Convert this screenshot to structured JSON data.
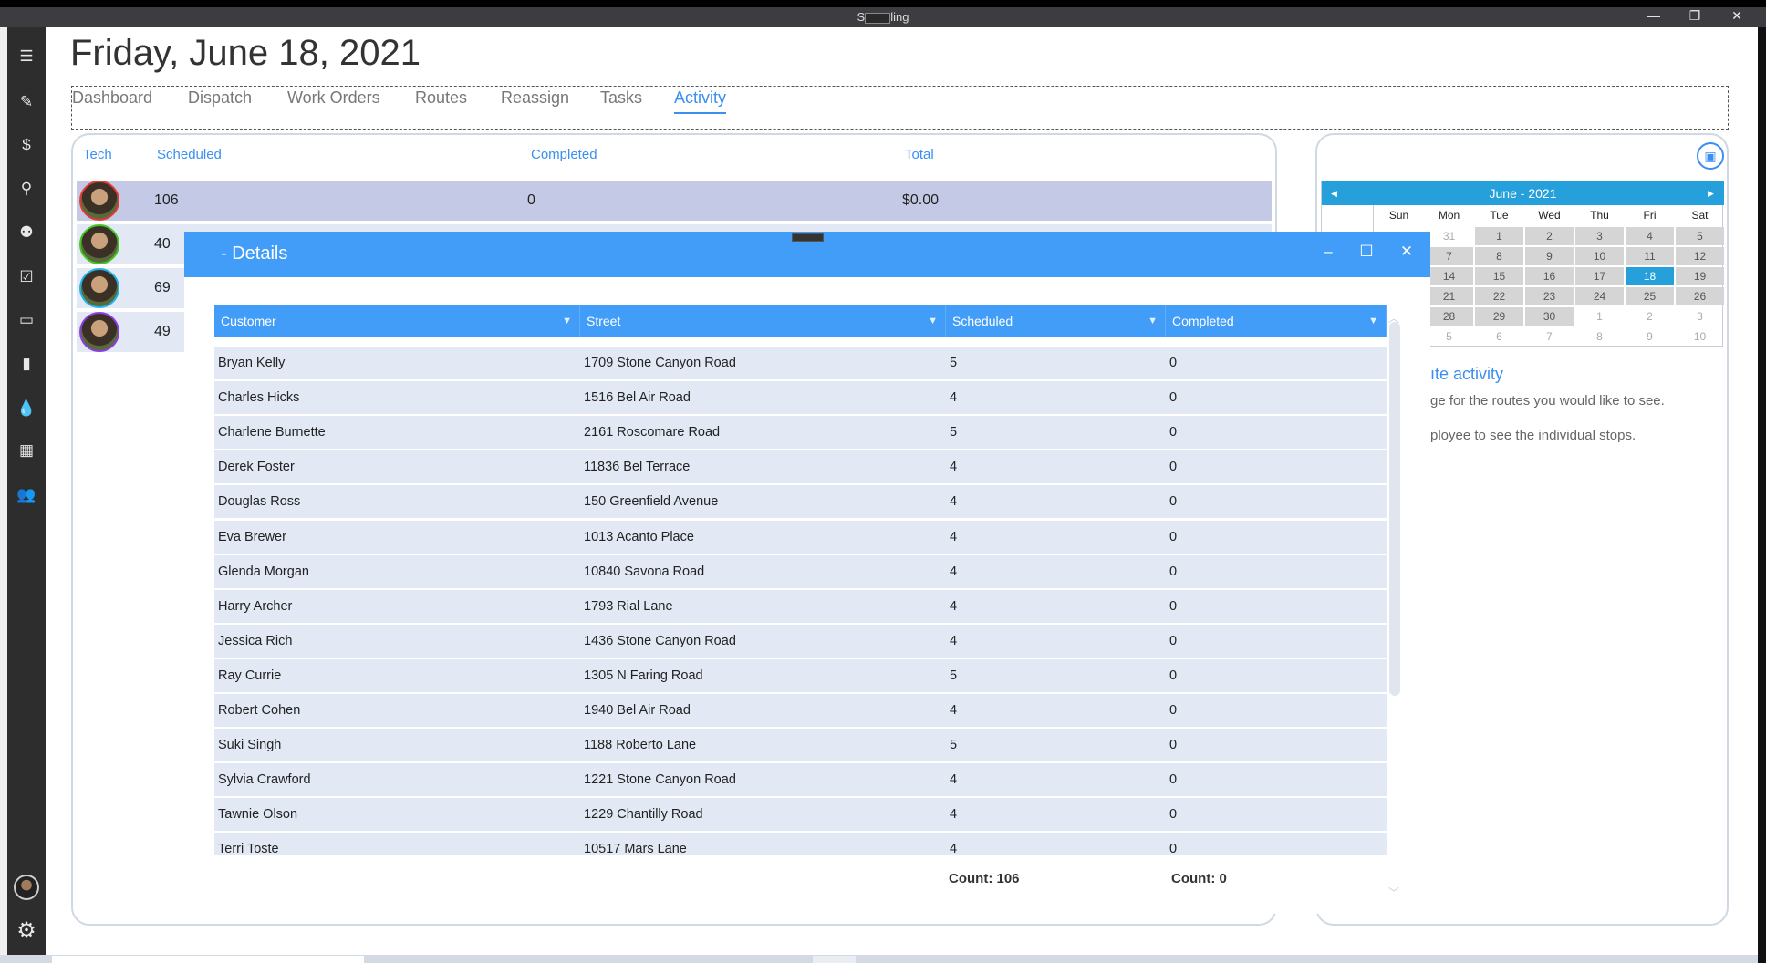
{
  "window": {
    "title_start": "S",
    "title_end": "ling",
    "minimize": "—",
    "restore": "❐",
    "close": "✕"
  },
  "sidebar": {
    "icons": [
      "menu-icon",
      "edit-icon",
      "billing-icon",
      "customer-search-icon",
      "team-icon",
      "clipboard-check-icon",
      "money-icon",
      "chart-icon",
      "water-drop-icon",
      "calendar-icon",
      "users-icon"
    ],
    "glyphs": [
      "☰",
      "✎",
      "$",
      "⚲",
      "⚉",
      "☑",
      "▭",
      "▮",
      "💧",
      "▦",
      "👥"
    ],
    "settings_glyph": "⚙"
  },
  "header": {
    "title": "Friday, June 18, 2021"
  },
  "tabs": [
    {
      "label": "Dashboard"
    },
    {
      "label": "Dispatch"
    },
    {
      "label": "Work Orders"
    },
    {
      "label": "Routes"
    },
    {
      "label": "Reassign"
    },
    {
      "label": "Tasks"
    },
    {
      "label": "Activity",
      "active": true
    }
  ],
  "techs": {
    "columns": [
      "Tech",
      "Scheduled",
      "Completed",
      "Total"
    ],
    "rows": [
      {
        "scheduled": "106",
        "completed": "0",
        "total": "$0.00",
        "ring": "#e53935"
      },
      {
        "scheduled": "40",
        "ring": "#43c524"
      },
      {
        "scheduled": "69",
        "ring": "#1fb4e8"
      },
      {
        "scheduled": "49",
        "ring": "#8e3ce0"
      }
    ]
  },
  "calendar": {
    "title": "June - 2021",
    "days_of_week": [
      "Sun",
      "Mon",
      "Tue",
      "Wed",
      "Thu",
      "Fri",
      "Sat"
    ],
    "weeks": [
      [
        "31",
        "1",
        "2",
        "3",
        "4",
        "5"
      ],
      [
        "7",
        "8",
        "9",
        "10",
        "11",
        "12"
      ],
      [
        "14",
        "15",
        "16",
        "17",
        "18",
        "19"
      ],
      [
        "21",
        "22",
        "23",
        "24",
        "25",
        "26"
      ],
      [
        "28",
        "29",
        "30",
        "1",
        "2",
        "3"
      ],
      [
        "5",
        "6",
        "7",
        "8",
        "9",
        "10"
      ]
    ],
    "selected": "18",
    "accent": "#26a0da"
  },
  "info": {
    "heading": "ıte activity",
    "line1": "ge for the routes you would like to see.",
    "line2": "ployee to see the individual stops."
  },
  "modal": {
    "title": "- Details",
    "columns": [
      "Customer",
      "Street",
      "Scheduled",
      "Completed"
    ],
    "rows": [
      [
        "Bryan Kelly",
        "1709 Stone Canyon Road",
        "5",
        "0"
      ],
      [
        "Charles Hicks",
        "1516 Bel Air Road",
        "4",
        "0"
      ],
      [
        "Charlene Burnette",
        "2161 Roscomare  Road",
        "5",
        "0"
      ],
      [
        "Derek Foster",
        "11836 Bel Terrace",
        "4",
        "0"
      ],
      [
        "Douglas Ross",
        "150 Greenfield Avenue",
        "4",
        "0"
      ],
      [
        "Eva Brewer",
        "1013 Acanto Place",
        "4",
        "0"
      ],
      [
        "Glenda Morgan",
        "10840 Savona Road",
        "4",
        "0"
      ],
      [
        "Harry Archer",
        "1793 Rial Lane",
        "4",
        "0"
      ],
      [
        "Jessica Rich",
        "1436 Stone Canyon Road",
        "4",
        "0"
      ],
      [
        "Ray Currie",
        "1305 N Faring Road",
        "5",
        "0"
      ],
      [
        "Robert Cohen",
        "1940 Bel Air Road",
        "4",
        "0"
      ],
      [
        "Suki Singh",
        "1188 Roberto Lane",
        "5",
        "0"
      ],
      [
        "Sylvia Crawford",
        "1221 Stone Canyon Road",
        "4",
        "0"
      ],
      [
        "Tawnie Olson",
        "1229 Chantilly Road",
        "4",
        "0"
      ],
      [
        "Terri Toste",
        "10517 Mars Lane",
        "4",
        "0"
      ]
    ],
    "scheduled_count": "Count:  106",
    "completed_count": "Count:  0",
    "header_color": "#429df8"
  }
}
